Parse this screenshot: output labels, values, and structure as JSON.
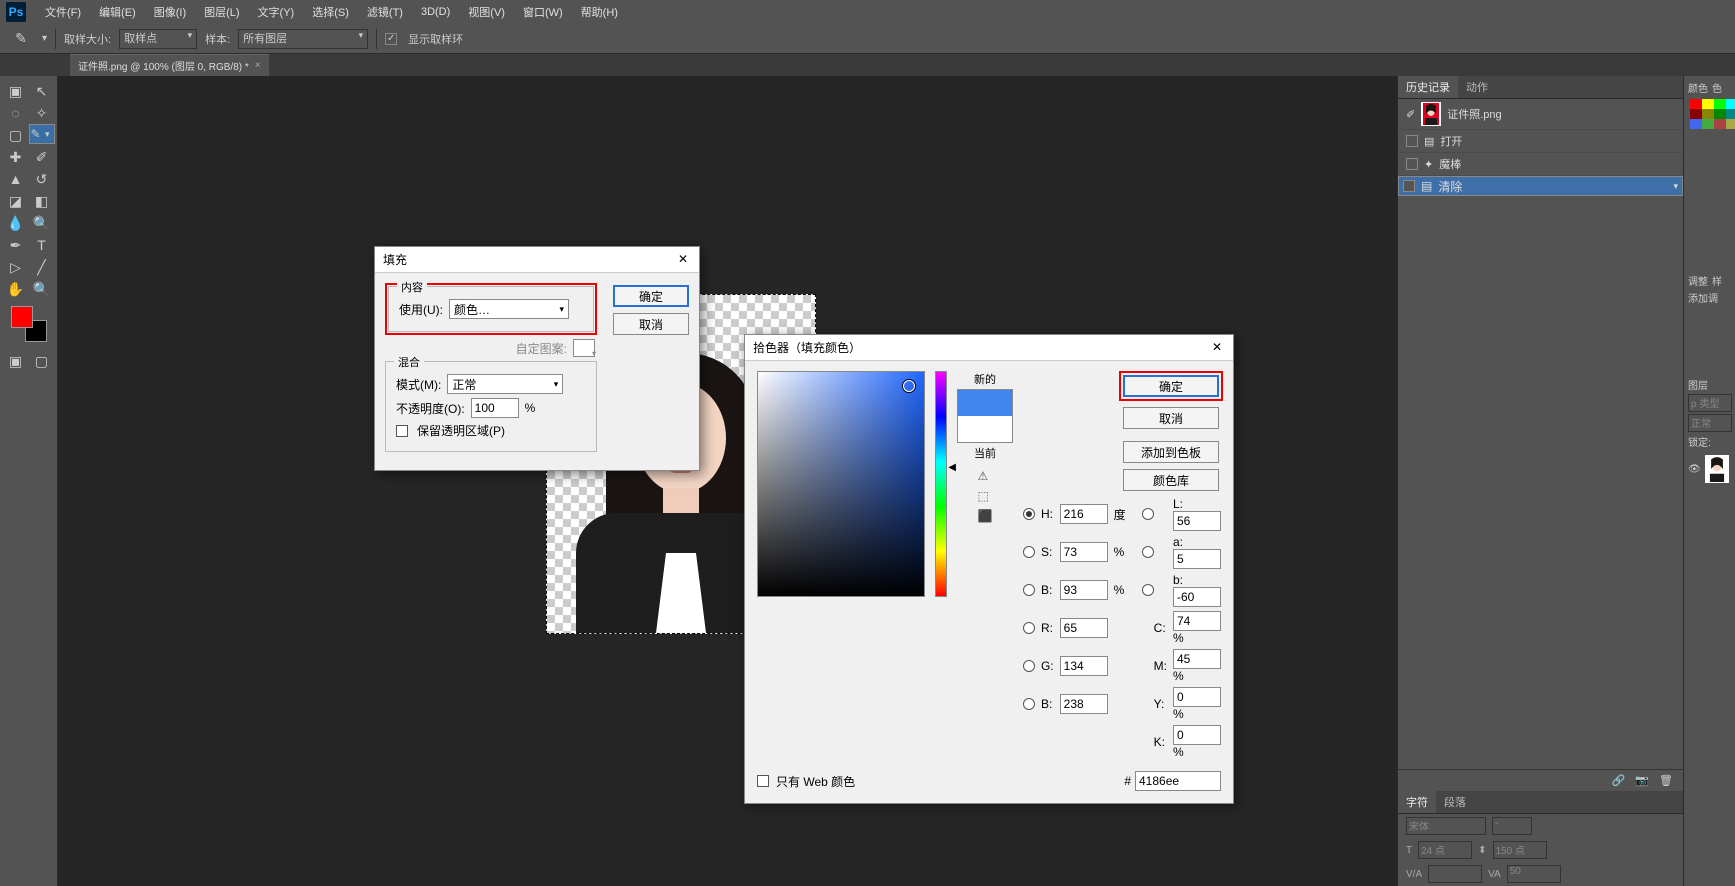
{
  "menu": {
    "file": "文件(F)",
    "edit": "编辑(E)",
    "image": "图像(I)",
    "layer": "图层(L)",
    "type": "文字(Y)",
    "select": "选择(S)",
    "filter": "滤镜(T)",
    "threeD": "3D(D)",
    "view": "视图(V)",
    "window": "窗口(W)",
    "help": "帮助(H)"
  },
  "opts": {
    "sampleSize": "取样大小:",
    "samplePoint": "取样点",
    "sample": "样本:",
    "allLayers": "所有图层",
    "showRing": "显示取样环"
  },
  "tab": {
    "title": "证件照.png @ 100% (图层 0, RGB/8) *"
  },
  "history": {
    "tabHistory": "历史记录",
    "tabAction": "动作",
    "doc": "证件照.png",
    "open": "打开",
    "magic": "魔棒",
    "clear": "清除"
  },
  "far": {
    "color": "颜色",
    "swatch": "色",
    "adjust": "调整",
    "style": "样",
    "addAdj": "添加调",
    "layer": "图层",
    "typeKind": "ρ 类型",
    "normal": "正常",
    "lock": "锁定:"
  },
  "char": {
    "tabChar": "字符",
    "tabPara": "段落",
    "font": "宋体",
    "pt": "点",
    "size": "24",
    "lead": "150",
    "va": "50"
  },
  "fill": {
    "title": "填充",
    "legendContent": "内容",
    "use": "使用(U):",
    "useVal": "颜色…",
    "custom": "自定图案:",
    "legendMix": "混合",
    "mode": "模式(M):",
    "modeVal": "正常",
    "opacity": "不透明度(O):",
    "opVal": "100",
    "pct": "%",
    "preserve": "保留透明区域(P)",
    "ok": "确定",
    "cancel": "取消"
  },
  "cp": {
    "title": "拾色器（填充颜色）",
    "ok": "确定",
    "cancel": "取消",
    "addSwatch": "添加到色板",
    "colorLib": "颜色库",
    "new_": "新的",
    "current": "当前",
    "webOnly": "只有 Web 颜色",
    "H": "H:",
    "S": "S:",
    "Bv": "B:",
    "L": "L:",
    "a": "a:",
    "b": "b:",
    "Rv": "R:",
    "Gv": "G:",
    "Bv2": "B:",
    "C": "C:",
    "M": "M:",
    "Y": "Y:",
    "K": "K:",
    "Hval": "216",
    "Hunit": "度",
    "Sval": "73",
    "Bvval": "93",
    "Lval": "56",
    "aval": "5",
    "bval": "-60",
    "Rval": "65",
    "Gval": "134",
    "B2val": "238",
    "Cval": "74",
    "Mval": "45",
    "Yval": "0",
    "Kval": "0",
    "hash": "#",
    "hex": "4186ee",
    "pct": "%"
  }
}
